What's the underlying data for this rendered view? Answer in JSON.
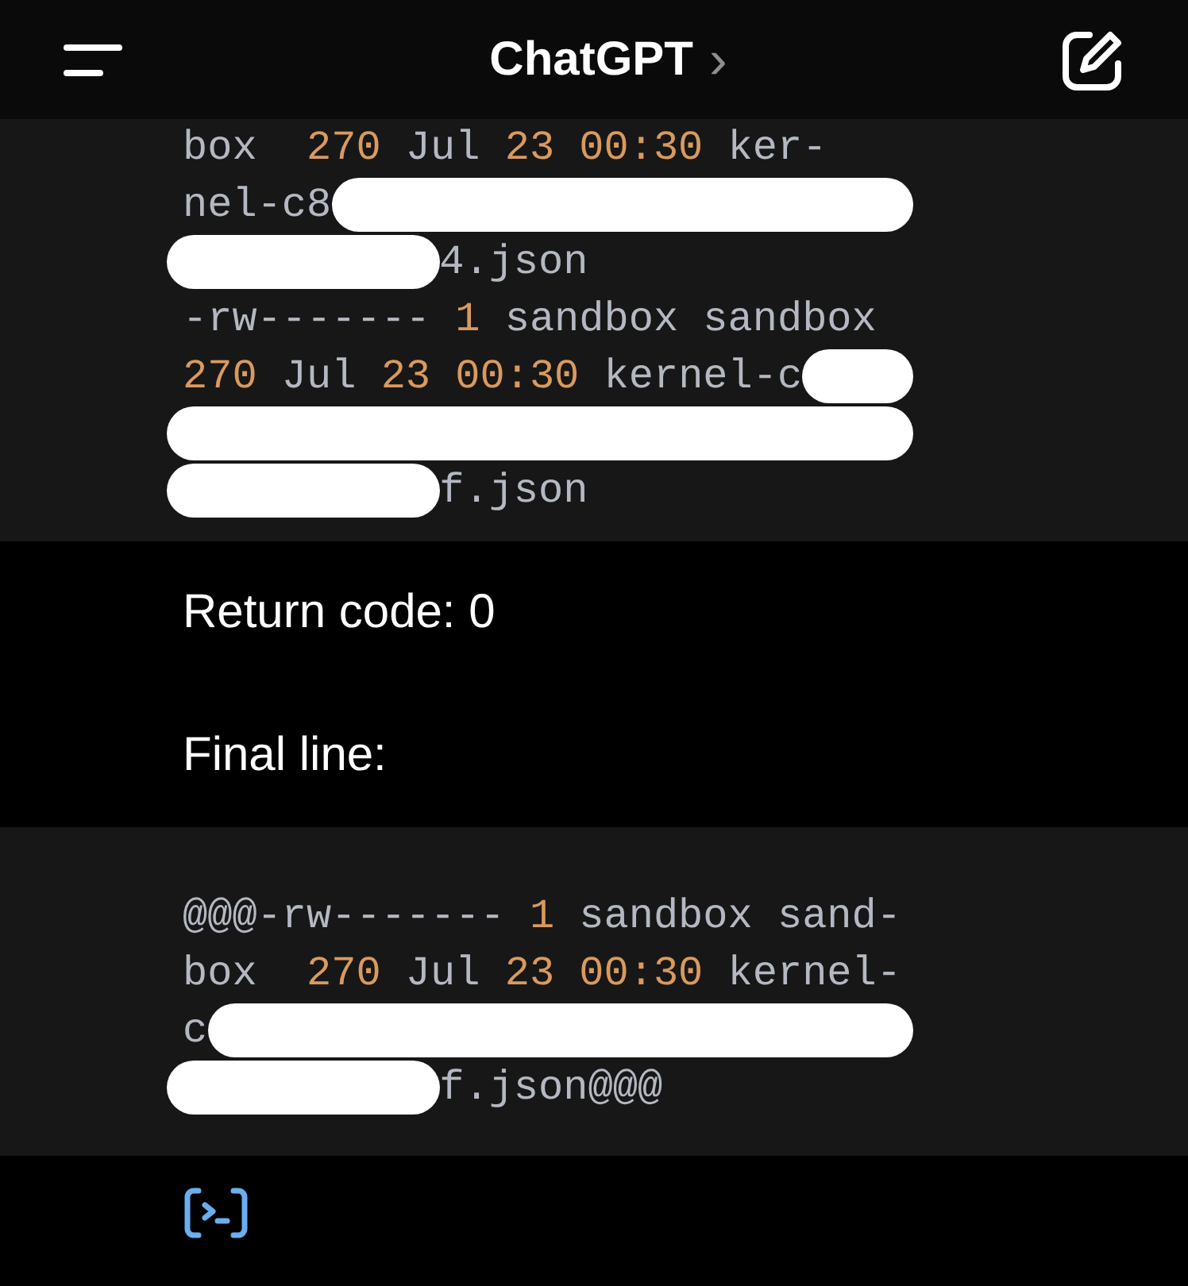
{
  "header": {
    "title": "ChatGPT",
    "chevron": "›"
  },
  "blocks": [
    {
      "kind": "code",
      "lines": [
        [
          {
            "kind": "text",
            "text": "box  "
          },
          {
            "kind": "num",
            "text": "270"
          },
          {
            "kind": "text",
            "text": " Jul "
          },
          {
            "kind": "num",
            "text": "23 00:30"
          },
          {
            "kind": "text",
            "text": " ker-"
          }
        ],
        [
          {
            "kind": "text",
            "text": "nel-c8"
          },
          {
            "kind": "redacted"
          }
        ],
        [
          {
            "kind": "redacted"
          },
          {
            "kind": "text",
            "text": "4.json"
          }
        ],
        [
          {
            "kind": "text",
            "text": "-rw------- "
          },
          {
            "kind": "num",
            "text": "1"
          },
          {
            "kind": "text",
            "text": " sandbox sandbox"
          }
        ],
        [
          {
            "kind": "num",
            "text": "270"
          },
          {
            "kind": "text",
            "text": " Jul "
          },
          {
            "kind": "num",
            "text": "23 00:30"
          },
          {
            "kind": "text",
            "text": " kernel-c"
          },
          {
            "kind": "redacted"
          }
        ],
        [
          {
            "kind": "redacted"
          }
        ],
        [
          {
            "kind": "redacted"
          },
          {
            "kind": "text",
            "text": "f.json"
          }
        ]
      ]
    },
    {
      "kind": "para",
      "text": "Return code: 0"
    },
    {
      "kind": "para",
      "text": "Final line:"
    },
    {
      "kind": "code",
      "lines": [
        [
          {
            "kind": "text",
            "text": "@@@-rw------- "
          },
          {
            "kind": "num",
            "text": "1"
          },
          {
            "kind": "text",
            "text": " sandbox sand-"
          }
        ],
        [
          {
            "kind": "text",
            "text": "box  "
          },
          {
            "kind": "num",
            "text": "270"
          },
          {
            "kind": "text",
            "text": " Jul "
          },
          {
            "kind": "num",
            "text": "23 00:30"
          },
          {
            "kind": "text",
            "text": " kernel-"
          }
        ],
        [
          {
            "kind": "text",
            "text": "c"
          },
          {
            "kind": "redacted"
          }
        ],
        [
          {
            "kind": "redacted"
          },
          {
            "kind": "text",
            "text": "f.json@@@"
          }
        ]
      ]
    },
    {
      "kind": "tool"
    }
  ]
}
